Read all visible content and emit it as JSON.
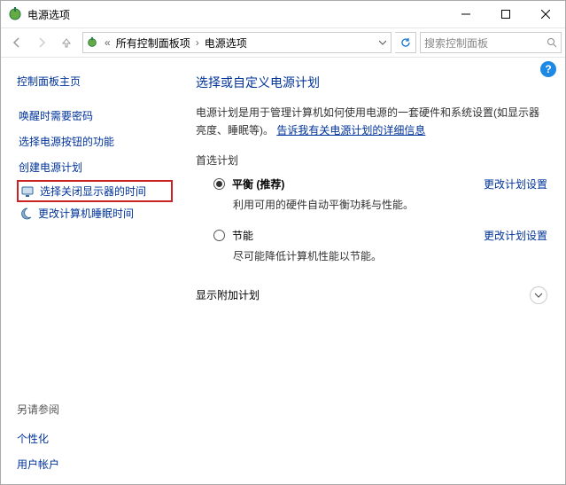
{
  "window": {
    "title": "电源选项"
  },
  "breadcrumb": {
    "level1": "所有控制面板项",
    "level2": "电源选项",
    "sep": "«"
  },
  "search": {
    "placeholder": "搜索控制面板"
  },
  "sidebar": {
    "home": "控制面板主页",
    "links": {
      "wake_pw": "唤醒时需要密码",
      "power_btn": "选择电源按钮的功能",
      "create_plan": "创建电源计划",
      "display_off": "选择关闭显示器的时间",
      "sleep_time": "更改计算机睡眠时间"
    },
    "footer": {
      "see_also": "另请参阅",
      "personalize": "个性化",
      "user_acct": "用户帐户"
    }
  },
  "main": {
    "heading": "选择或自定义电源计划",
    "desc_a": "电源计划是用于管理计算机如何使用电源的一套硬件和系统设置(如显示器亮度、睡眠等)。",
    "desc_link": "告诉我有关电源计划的详细信息",
    "pref_label": "首选计划",
    "plans": {
      "balanced": {
        "name": "平衡 (推荐)",
        "sub": "利用可用的硬件自动平衡功耗与性能。"
      },
      "saver": {
        "name": "节能",
        "sub": "尽可能降低计算机性能以节能。"
      }
    },
    "change_label": "更改计划设置",
    "additional_label": "显示附加计划"
  }
}
